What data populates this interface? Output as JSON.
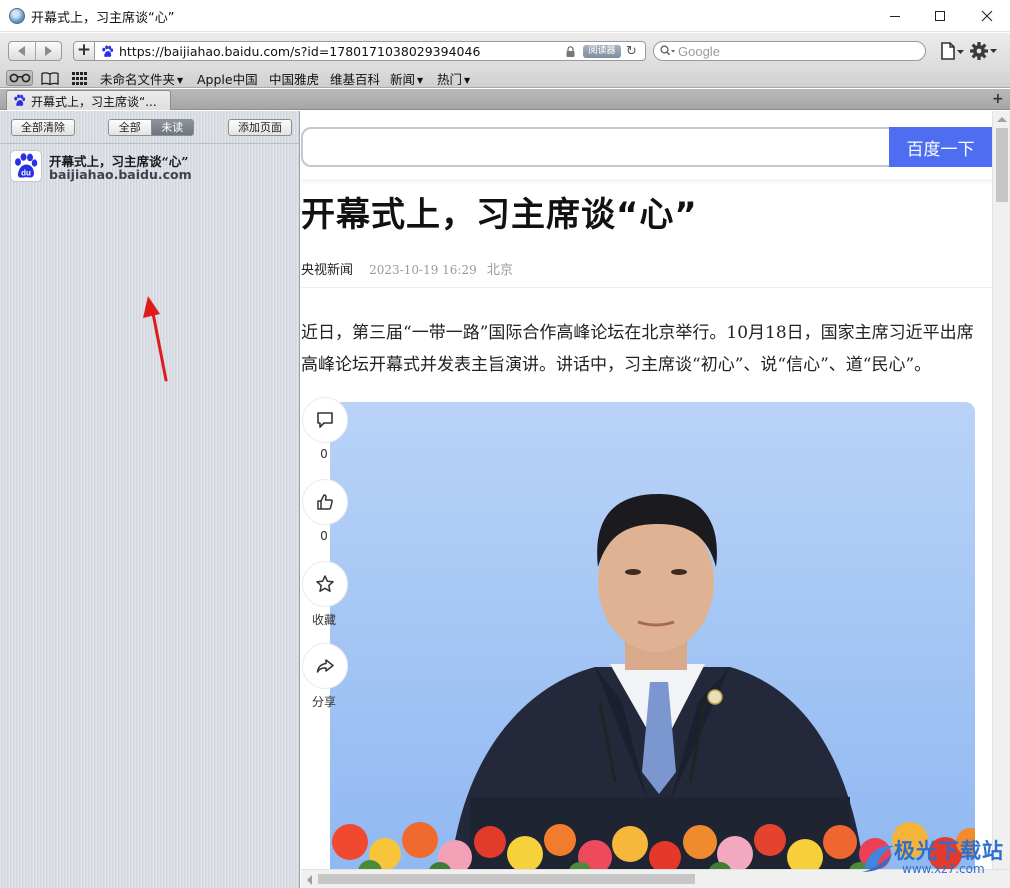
{
  "window": {
    "title": "开幕式上，习主席谈“心”",
    "controls": [
      "minimize",
      "maximize",
      "close"
    ]
  },
  "toolbar": {
    "back_icon": "back-arrow-icon",
    "forward_icon": "forward-arrow-icon",
    "add_label": "+",
    "url": "https://baijiahao.baidu.com/s?id=1780171038029394046",
    "reader_label": "阅读器",
    "search_placeholder": "Google"
  },
  "bookmarks": {
    "items": [
      {
        "label": "未命名文件夹",
        "has_menu": true
      },
      {
        "label": "Apple中国",
        "has_menu": false
      },
      {
        "label": "中国雅虎",
        "has_menu": false
      },
      {
        "label": "维基百科",
        "has_menu": false
      },
      {
        "label": "新闻",
        "has_menu": true
      },
      {
        "label": "热门",
        "has_menu": true
      }
    ],
    "caret": "▼"
  },
  "tabs": [
    {
      "title": "开幕式上，习主席谈“...",
      "active": true
    }
  ],
  "sidebar": {
    "clear_all": "全部清除",
    "filter_all": "全部",
    "filter_unread": "未读",
    "add_page": "添加页面",
    "items": [
      {
        "title": "开幕式上，习主席谈“心”",
        "domain": "baijiahao.baidu.com",
        "icon": "baidu-paw-icon"
      }
    ]
  },
  "article": {
    "search_button": "百度一下",
    "title": "开幕式上，习主席谈“心”",
    "source": "央视新闻",
    "datetime": "2023-10-19 16:29",
    "location": "北京",
    "body": "近日，第三届“一带一路”国际合作高峰论坛在北京举行。10月18日，国家主席习近平出席高峰论坛开幕式并发表主旨演讲。讲话中，习主席谈“初心”、说“信心”、道“民心”。",
    "actions": [
      {
        "icon": "comment-icon",
        "label": "0"
      },
      {
        "icon": "thumbs-up-icon",
        "label": "0"
      },
      {
        "icon": "star-icon",
        "label": "收藏"
      },
      {
        "icon": "share-icon",
        "label": "分享"
      }
    ]
  },
  "watermark": {
    "text": "极光下载站",
    "sub": "www.xz7.com"
  },
  "colors": {
    "baidu_blue": "#4e6ef2",
    "annotation_red": "#e01b1b",
    "sidebar_bg": "#d9dde4",
    "watermark_blue": "#2d6fcf"
  }
}
